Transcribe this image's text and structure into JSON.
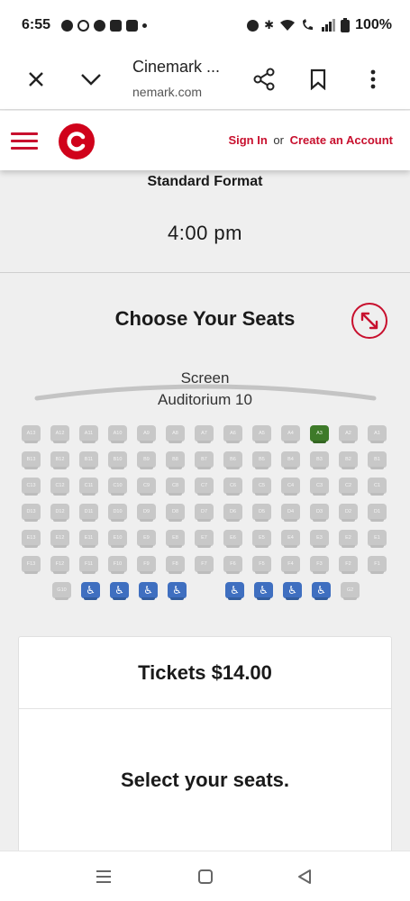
{
  "status_bar": {
    "time": "6:55",
    "battery": "100%"
  },
  "browser": {
    "title": "Cinemark ...",
    "url": "nemark.com"
  },
  "site_header": {
    "sign_in": "Sign In",
    "or": "or",
    "create_account": "Create an Account",
    "brand_color": "#c8102e"
  },
  "showing": {
    "format": "Standard Format",
    "time": "4:00 pm"
  },
  "seating": {
    "heading": "Choose Your Seats",
    "screen_label": "Screen",
    "auditorium": "Auditorium 10",
    "colors": {
      "available": "#c8c8c8",
      "selected": "#3e7a29",
      "accessible": "#3f6fc0"
    },
    "rows": [
      {
        "row": "A",
        "seats": [
          "A13",
          "A12",
          "A11",
          "A10",
          "A9",
          "A8",
          "A7",
          "A6",
          "A5",
          "A4",
          "A3",
          "A2",
          "A1"
        ],
        "selected": [
          "A3"
        ]
      },
      {
        "row": "B",
        "seats": [
          "B13",
          "B12",
          "B11",
          "B10",
          "B9",
          "B8",
          "B7",
          "B6",
          "B5",
          "B4",
          "B3",
          "B2",
          "B1"
        ]
      },
      {
        "row": "C",
        "seats": [
          "C13",
          "C12",
          "C11",
          "C10",
          "C9",
          "C8",
          "C7",
          "C6",
          "C5",
          "C4",
          "C3",
          "C2",
          "C1"
        ]
      },
      {
        "row": "D",
        "seats": [
          "D13",
          "D12",
          "D11",
          "D10",
          "D9",
          "D8",
          "D7",
          "D6",
          "D5",
          "D4",
          "D3",
          "D2",
          "D1"
        ]
      },
      {
        "row": "E",
        "seats": [
          "E13",
          "E12",
          "E11",
          "E10",
          "E9",
          "E8",
          "E7",
          "E6",
          "E5",
          "E4",
          "E3",
          "E2",
          "E1"
        ]
      },
      {
        "row": "F",
        "seats": [
          "F13",
          "F12",
          "F11",
          "F10",
          "F9",
          "F8",
          "F7",
          "F6",
          "F5",
          "F4",
          "F3",
          "F2",
          "F1"
        ]
      },
      {
        "row": "G",
        "seats": [
          "G10",
          "",
          "",
          "",
          "",
          "",
          "",
          "",
          "",
          "G2"
        ],
        "accessible_slots": [
          1,
          2,
          3,
          4,
          5,
          6,
          7,
          8
        ]
      }
    ]
  },
  "tickets": {
    "title": "Tickets $14.00",
    "message": "Select your seats."
  }
}
